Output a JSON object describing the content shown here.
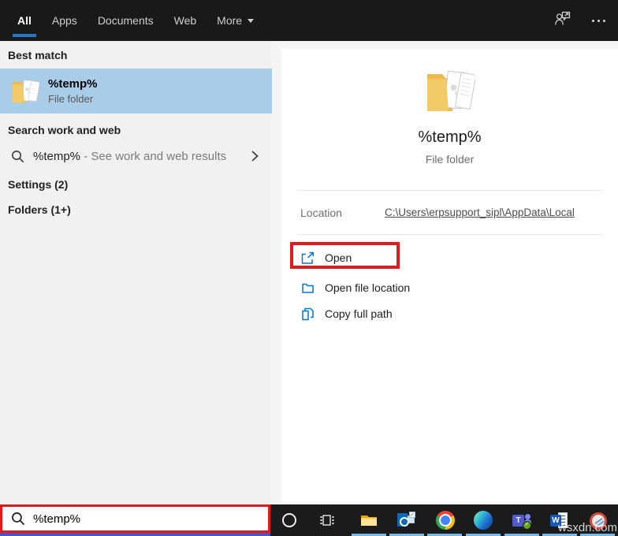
{
  "topbar": {
    "tabs": [
      {
        "label": "All",
        "active": true
      },
      {
        "label": "Apps",
        "active": false
      },
      {
        "label": "Documents",
        "active": false
      },
      {
        "label": "Web",
        "active": false
      },
      {
        "label": "More",
        "active": false,
        "has_dropdown": true
      }
    ]
  },
  "left_panel": {
    "best_match_header": "Best match",
    "best_match_title": "%temp%",
    "best_match_subtitle": "File folder",
    "search_web_header": "Search work and web",
    "web_query": "%temp%",
    "web_suffix": " - See work and web results",
    "settings_header": "Settings (2)",
    "folders_header": "Folders (1+)"
  },
  "detail_panel": {
    "title": "%temp%",
    "subtitle": "File folder",
    "location_label": "Location",
    "location_value": "C:\\Users\\erpsupport_sipl\\AppData\\Local",
    "actions": [
      {
        "label": "Open",
        "annotated": true
      },
      {
        "label": "Open file location",
        "annotated": false
      },
      {
        "label": "Copy full path",
        "annotated": false
      }
    ]
  },
  "search_bar": {
    "value": "%temp%"
  },
  "taskbar": {
    "icons": [
      "cortana",
      "task-view",
      "file-explorer",
      "outlook",
      "chrome",
      "edge",
      "teams",
      "word",
      "red-app"
    ]
  },
  "watermark": "wsxdn.com",
  "icons": {
    "ellipsis-icon": "three-dots",
    "feedback-person-icon": "person-with-speech-bubble",
    "search-icon": "magnifier",
    "chevron-right-icon": "angle-right",
    "open-icon": "box-with-external-arrow",
    "open-file-location-icon": "folder-outline",
    "copy-icon": "two-pages",
    "folder-icon": "yellow-folder-with-documents"
  },
  "colors": {
    "accent_blue": "#2676cc",
    "highlight_blue": "#a9cce9",
    "annotation_red": "#e01b1b",
    "action_icon_blue": "#0076d7",
    "taskbar_underline": "#76b9ed"
  }
}
